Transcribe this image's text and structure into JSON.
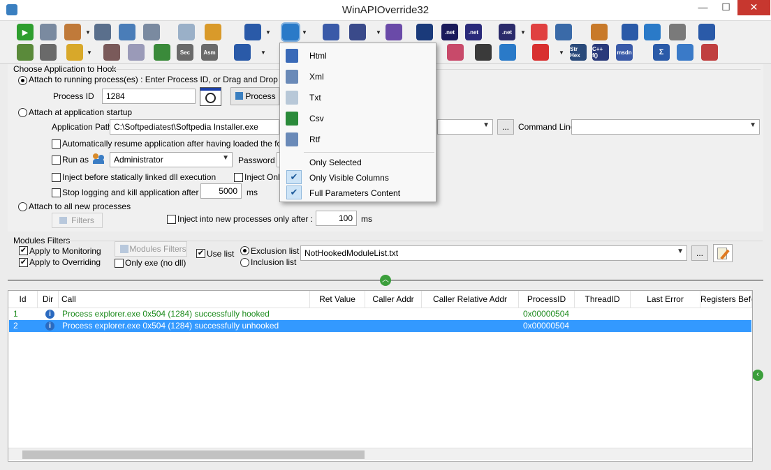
{
  "window": {
    "title": "WinAPIOverride32",
    "minimize": "—",
    "maximize": "☐",
    "close": "✕"
  },
  "toolbar": {
    "row1": [
      "▶",
      "",
      "",
      "",
      "",
      "",
      "",
      "",
      "",
      "",
      "",
      "",
      "",
      "",
      ".net",
      ".net",
      ".net",
      "",
      "",
      "",
      "",
      "",
      "",
      ""
    ],
    "row2": [
      "",
      "",
      "",
      "",
      "",
      "",
      "Sec",
      "Asm",
      "",
      "",
      "",
      "",
      "",
      "",
      "",
      "",
      "",
      "",
      "Str Hex",
      "C++ f()",
      "msdn",
      "Σ",
      "",
      ""
    ]
  },
  "hook": {
    "group_title": "Choose Application to Hook",
    "attach_running_label": "Attach to running process(es) : Enter Process ID, or Drag and Drop the Cro",
    "process_id_label": "Process ID",
    "process_id_value": "1284",
    "process_button": "Process",
    "attach_startup_label": "Attach at application startup",
    "app_path_label": "Application Path",
    "app_path_value": "C:\\Softpediatest\\Softpedia Installer.exe",
    "browse_label": "...",
    "command_line_label": "Command Line",
    "command_line_value": "",
    "auto_resume_label": "Automatically resume application after having loaded the followin",
    "run_as_label": "Run as",
    "run_as_value": "Administrator",
    "password_label": "Password",
    "inject_static_label": "Inject before statically linked dll execution",
    "inject_only_label": "Inject Only",
    "stop_logging_label": "Stop logging and kill application after :",
    "stop_logging_value": "5000",
    "stop_logging_unit": "ms",
    "attach_all_label": "Attach to all new processes",
    "filters_button": "Filters",
    "inject_new_label": "Inject into new processes only after :",
    "inject_new_value": "100",
    "inject_new_unit": "ms"
  },
  "modules": {
    "group_title": "Modules Filters",
    "apply_monitoring": "Apply to Monitoring",
    "apply_overriding": "Apply to Overriding",
    "modules_filters_button": "Modules Filters",
    "only_exe": "Only exe (no dll)",
    "use_list": "Use list",
    "exclusion_list": "Exclusion list",
    "inclusion_list": "Inclusion list",
    "list_value": "NotHookedModuleList.txt",
    "browse_label": "..."
  },
  "grid": {
    "columns": [
      "Id",
      "Dir",
      "Call",
      "Ret Value",
      "Caller Addr",
      "Caller Relative Addr",
      "ProcessID",
      "ThreadID",
      "Last Error",
      "Registers Befo"
    ],
    "rows": [
      {
        "id": "1",
        "dir": "i",
        "call": "Process explorer.exe 0x504 (1284) successfully hooked",
        "pid": "0x00000504"
      },
      {
        "id": "2",
        "dir": "i",
        "call": "Process explorer.exe 0x504 (1284) successfully unhooked",
        "pid": "0x00000504"
      }
    ]
  },
  "menu": {
    "items": [
      {
        "label": "Html",
        "icon": "html-file-icon"
      },
      {
        "label": "Xml",
        "icon": "xml-file-icon"
      },
      {
        "label": "Txt",
        "icon": "txt-file-icon"
      },
      {
        "label": "Csv",
        "icon": "csv-file-icon"
      },
      {
        "label": "Rtf",
        "icon": "rtf-file-icon"
      }
    ],
    "options": [
      {
        "label": "Only Selected",
        "checked": false
      },
      {
        "label": "Only Visible Columns",
        "checked": true
      },
      {
        "label": "Full Parameters Content",
        "checked": true
      }
    ],
    "check_glyph": "✔"
  },
  "colors": {
    "selection": "#3399ff",
    "hooked_text": "#1d8b1d",
    "close_button": "#c7372f"
  }
}
